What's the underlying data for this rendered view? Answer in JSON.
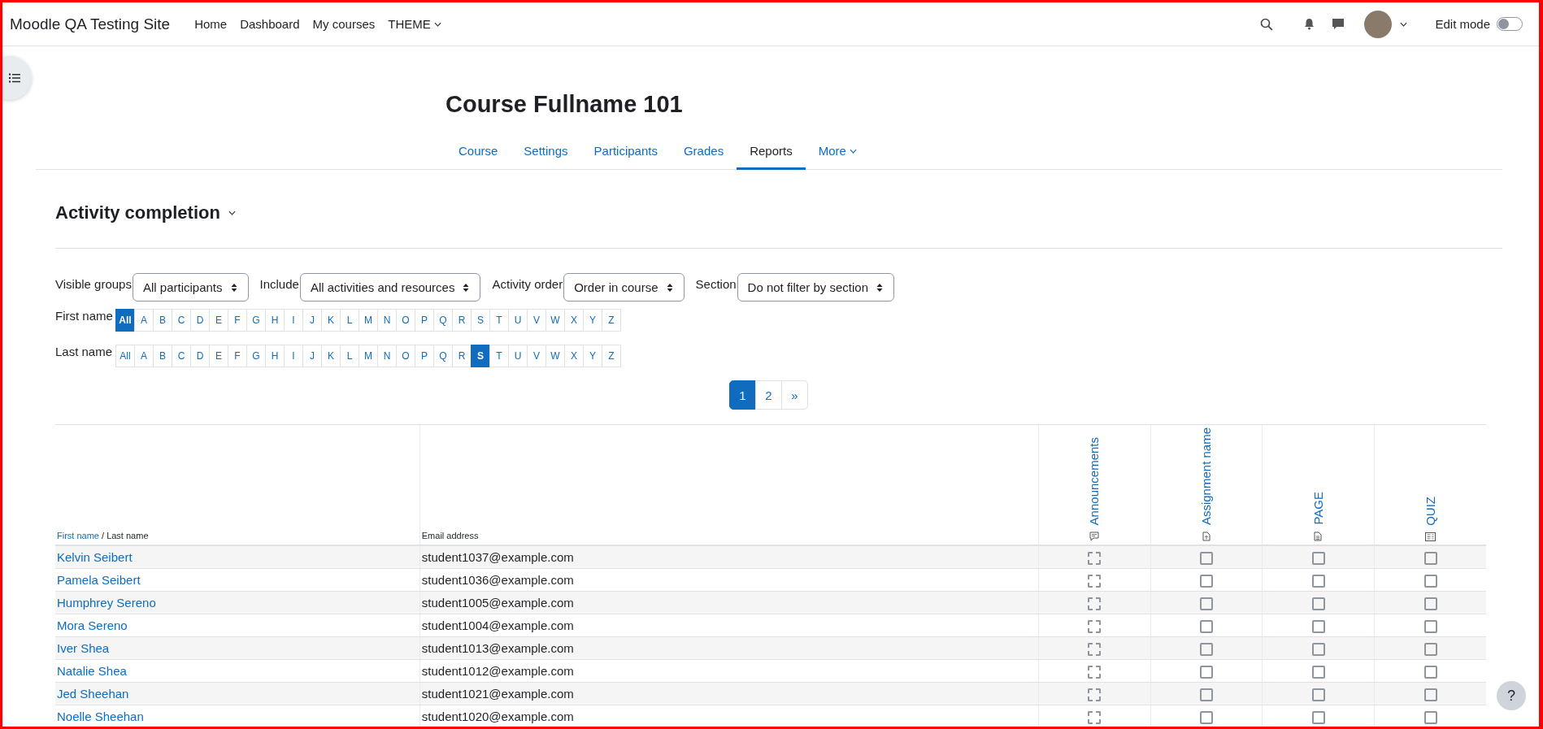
{
  "navbar": {
    "site_name": "Moodle QA Testing Site",
    "links": [
      {
        "label": "Home"
      },
      {
        "label": "Dashboard"
      },
      {
        "label": "My courses"
      },
      {
        "label": "THEME",
        "dropdown": true
      }
    ],
    "edit_mode": {
      "label": "Edit mode",
      "on": false
    }
  },
  "course": {
    "title": "Course Fullname 101",
    "tabs": [
      {
        "label": "Course",
        "selected": false,
        "dropdown": false
      },
      {
        "label": "Settings",
        "selected": false,
        "dropdown": false
      },
      {
        "label": "Participants",
        "selected": false,
        "dropdown": false
      },
      {
        "label": "Grades",
        "selected": false,
        "dropdown": false
      },
      {
        "label": "Reports",
        "selected": true,
        "dropdown": false
      },
      {
        "label": "More",
        "selected": false,
        "dropdown": true
      }
    ]
  },
  "report": {
    "title": "Activity completion",
    "filters": [
      {
        "label": "Visible groups",
        "value": "All participants"
      },
      {
        "label": "Include",
        "value": "All activities and resources"
      },
      {
        "label": "Activity order",
        "value": "Order in course"
      },
      {
        "label": "Section",
        "value": "Do not filter by section"
      }
    ],
    "initials_bars": [
      {
        "label": "First name",
        "letters": [
          {
            "label": "All",
            "selected": true
          },
          {
            "label": "A",
            "selected": false
          },
          {
            "label": "B",
            "selected": false
          },
          {
            "label": "C",
            "selected": false
          },
          {
            "label": "D",
            "selected": false
          },
          {
            "label": "E",
            "selected": false
          },
          {
            "label": "F",
            "selected": false
          },
          {
            "label": "G",
            "selected": false
          },
          {
            "label": "H",
            "selected": false
          },
          {
            "label": "I",
            "selected": false
          },
          {
            "label": "J",
            "selected": false
          },
          {
            "label": "K",
            "selected": false
          },
          {
            "label": "L",
            "selected": false
          },
          {
            "label": "M",
            "selected": false
          },
          {
            "label": "N",
            "selected": false
          },
          {
            "label": "O",
            "selected": false
          },
          {
            "label": "P",
            "selected": false
          },
          {
            "label": "Q",
            "selected": false
          },
          {
            "label": "R",
            "selected": false
          },
          {
            "label": "S",
            "selected": false
          },
          {
            "label": "T",
            "selected": false
          },
          {
            "label": "U",
            "selected": false
          },
          {
            "label": "V",
            "selected": false
          },
          {
            "label": "W",
            "selected": false
          },
          {
            "label": "X",
            "selected": false
          },
          {
            "label": "Y",
            "selected": false
          },
          {
            "label": "Z",
            "selected": false
          }
        ]
      },
      {
        "label": "Last name",
        "letters": [
          {
            "label": "All",
            "selected": false
          },
          {
            "label": "A",
            "selected": false
          },
          {
            "label": "B",
            "selected": false
          },
          {
            "label": "C",
            "selected": false
          },
          {
            "label": "D",
            "selected": false
          },
          {
            "label": "E",
            "selected": false
          },
          {
            "label": "F",
            "selected": false
          },
          {
            "label": "G",
            "selected": false
          },
          {
            "label": "H",
            "selected": false
          },
          {
            "label": "I",
            "selected": false
          },
          {
            "label": "J",
            "selected": false
          },
          {
            "label": "K",
            "selected": false
          },
          {
            "label": "L",
            "selected": false
          },
          {
            "label": "M",
            "selected": false
          },
          {
            "label": "N",
            "selected": false
          },
          {
            "label": "O",
            "selected": false
          },
          {
            "label": "P",
            "selected": false
          },
          {
            "label": "Q",
            "selected": false
          },
          {
            "label": "R",
            "selected": false
          },
          {
            "label": "S",
            "selected": true
          },
          {
            "label": "T",
            "selected": false
          },
          {
            "label": "U",
            "selected": false
          },
          {
            "label": "V",
            "selected": false
          },
          {
            "label": "W",
            "selected": false
          },
          {
            "label": "X",
            "selected": false
          },
          {
            "label": "Y",
            "selected": false
          },
          {
            "label": "Z",
            "selected": false
          }
        ]
      }
    ],
    "pagination": [
      {
        "label": "1",
        "selected": true
      },
      {
        "label": "2",
        "selected": false
      },
      {
        "label": "»",
        "selected": false
      }
    ],
    "table": {
      "name_header": {
        "first": "First name",
        "separator": " / ",
        "last": "Last name"
      },
      "email_header": "Email address",
      "activities": [
        {
          "name": "Announcements",
          "kind": "forum",
          "automatic_completion": true
        },
        {
          "name": "Assignment name",
          "kind": "assignment",
          "automatic_completion": false
        },
        {
          "name": "PAGE",
          "kind": "page",
          "automatic_completion": false
        },
        {
          "name": "QUIZ",
          "kind": "quiz",
          "automatic_completion": false
        }
      ],
      "rows": [
        {
          "name": "Kelvin Seibert",
          "email": "student1037@example.com",
          "completed": [
            false,
            false,
            false,
            false
          ]
        },
        {
          "name": "Pamela Seibert",
          "email": "student1036@example.com",
          "completed": [
            false,
            false,
            false,
            false
          ]
        },
        {
          "name": "Humphrey Sereno",
          "email": "student1005@example.com",
          "completed": [
            false,
            false,
            false,
            false
          ]
        },
        {
          "name": "Mora Sereno",
          "email": "student1004@example.com",
          "completed": [
            false,
            false,
            false,
            false
          ]
        },
        {
          "name": "Iver Shea",
          "email": "student1013@example.com",
          "completed": [
            false,
            false,
            false,
            false
          ]
        },
        {
          "name": "Natalie Shea",
          "email": "student1012@example.com",
          "completed": [
            false,
            false,
            false,
            false
          ]
        },
        {
          "name": "Jed Sheehan",
          "email": "student1021@example.com",
          "completed": [
            false,
            false,
            false,
            false
          ]
        },
        {
          "name": "Noelle Sheehan",
          "email": "student1020@example.com",
          "completed": [
            false,
            false,
            false,
            false
          ]
        }
      ]
    }
  },
  "help_button": {
    "label": "?"
  }
}
